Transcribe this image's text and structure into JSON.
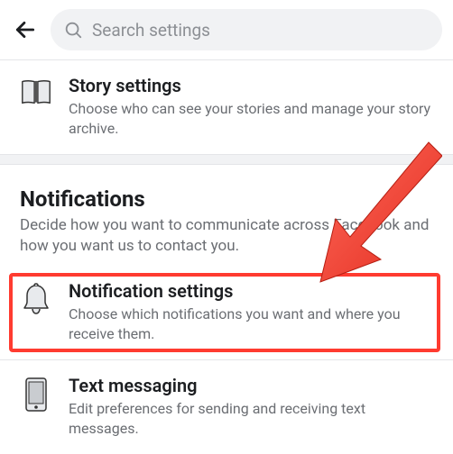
{
  "header": {
    "search_placeholder": "Search settings"
  },
  "story_row": {
    "title": "Story settings",
    "desc": "Choose who can see your stories and manage your story archive."
  },
  "section": {
    "heading": "Notifications",
    "subheading": "Decide how you want to communicate across Facebook and how you want us to contact you."
  },
  "notif_row": {
    "title": "Notification settings",
    "desc": "Choose which notifications you want and where you receive them."
  },
  "text_row": {
    "title": "Text messaging",
    "desc": "Edit preferences for sending and receiving text messages."
  }
}
